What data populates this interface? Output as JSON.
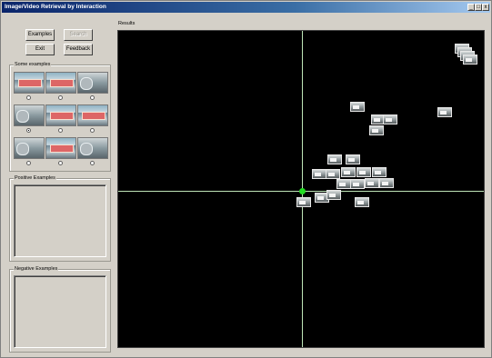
{
  "window": {
    "title": "Image/Video Retrieval by Interaction",
    "controls": [
      "_",
      "□",
      "x"
    ]
  },
  "buttons": {
    "examples": "Examples",
    "search": "Search",
    "exit": "Exit",
    "feedback": "Feedback"
  },
  "groups": {
    "some_examples": "Some examples",
    "positive": "Positive Examples",
    "negative": "Negative Examples",
    "results": "Results"
  },
  "example_thumbs": [
    {
      "kind": "car-video-frame",
      "selected": false
    },
    {
      "kind": "car-video-frame",
      "selected": false
    },
    {
      "kind": "close-up-frame",
      "selected": false
    },
    {
      "kind": "close-up-frame",
      "selected": true
    },
    {
      "kind": "car-video-frame",
      "selected": false
    },
    {
      "kind": "car-video-frame",
      "selected": false
    },
    {
      "kind": "close-up-frame",
      "selected": false
    },
    {
      "kind": "car-video-frame",
      "selected": false
    },
    {
      "kind": "close-up-frame",
      "selected": false
    }
  ],
  "results_plot": {
    "background": "#000000",
    "axis_color": "#bfe6b8",
    "origin_color": "#22dd22",
    "result_count": 24
  }
}
